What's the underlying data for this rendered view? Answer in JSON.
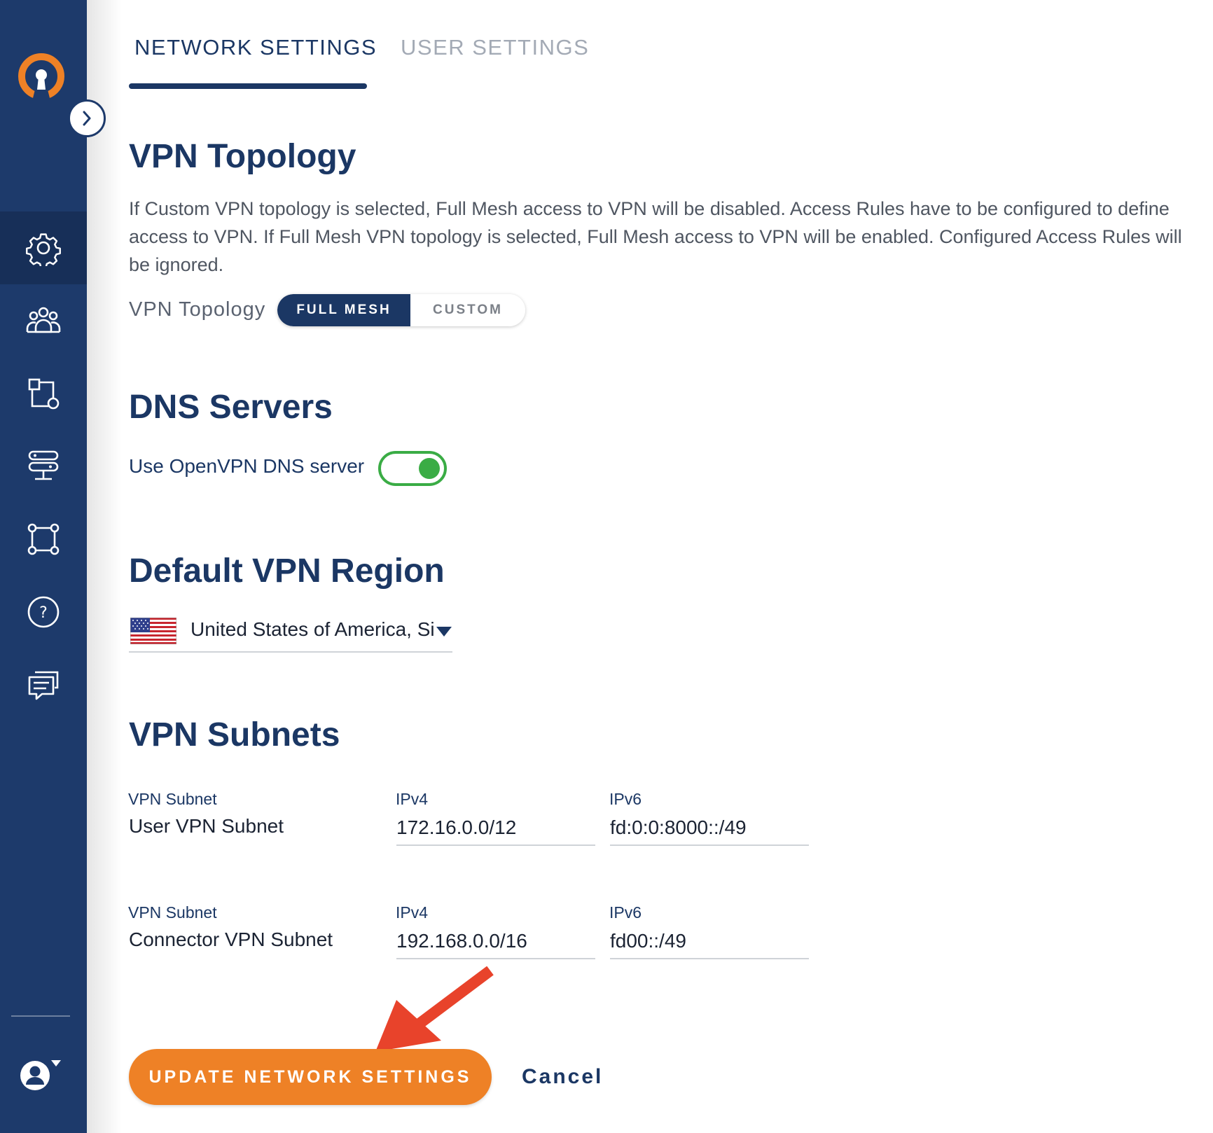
{
  "tabs": {
    "network": "NETWORK SETTINGS",
    "user": "USER SETTINGS"
  },
  "topology": {
    "title": "VPN Topology",
    "description": "If Custom VPN topology is selected, Full Mesh access to VPN will be disabled. Access Rules have to be configured to define access to VPN. If Full Mesh VPN topology is selected, Full Mesh access to VPN will be enabled. Configured Access Rules will be ignored.",
    "label": "VPN Topology",
    "options": [
      "FULL MESH",
      "CUSTOM"
    ],
    "selected": "FULL MESH"
  },
  "dns": {
    "title": "DNS Servers",
    "toggle_label": "Use OpenVPN DNS server",
    "enabled": true
  },
  "region": {
    "title": "Default VPN Region",
    "selected": "United States of America, Silicon Valley",
    "flag_icon": "us-flag-icon"
  },
  "subnets": {
    "title": "VPN Subnets",
    "rows": [
      {
        "type_label": "VPN Subnet",
        "name": "User VPN Subnet",
        "ipv4_label": "IPv4",
        "ipv4": "172.16.0.0/12",
        "ipv6_label": "IPv6",
        "ipv6": "fd:0:0:8000::/49"
      },
      {
        "type_label": "VPN Subnet",
        "name": "Connector VPN Subnet",
        "ipv4_label": "IPv4",
        "ipv4": "192.168.0.0/16",
        "ipv6_label": "IPv6",
        "ipv6": "fd00::/49"
      }
    ]
  },
  "actions": {
    "update": "UPDATE NETWORK SETTINGS",
    "cancel": "Cancel"
  },
  "colors": {
    "sidebar": "#1d3a6b",
    "primary": "#1b3764",
    "accent": "#ee8126",
    "toggle_on": "#3aac45",
    "annotation_arrow": "#e8432b"
  }
}
